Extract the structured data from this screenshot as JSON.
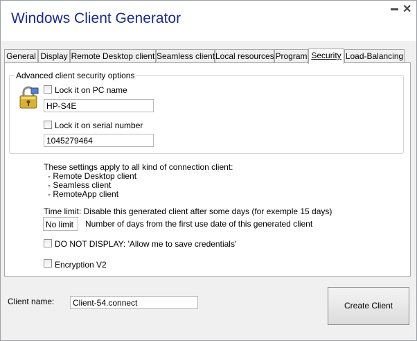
{
  "window": {
    "title": "Windows Client Generator",
    "minimize_glyph": "_",
    "close_glyph": "✕"
  },
  "tabs": [
    {
      "label": "General"
    },
    {
      "label": "Display"
    },
    {
      "label": "Remote Desktop client"
    },
    {
      "label": "Seamless client"
    },
    {
      "label": "Local resources"
    },
    {
      "label": "Program"
    },
    {
      "label": "Security"
    },
    {
      "label": "Load-Balancing"
    }
  ],
  "active_tab": "Security",
  "security": {
    "group_title": "Advanced client security options",
    "lock_pc": {
      "label": "Lock it on PC name",
      "checked": false,
      "value": "HP-S4E"
    },
    "lock_serial": {
      "label": "Lock it on serial number",
      "checked": false,
      "value": "1045279464"
    },
    "note": {
      "heading": "These settings apply to all kind of connection client:",
      "items": [
        "- Remote Desktop client",
        "- Seamless client",
        "- RemoteApp client"
      ]
    },
    "time_limit": {
      "label": "Time limit: Disable this generated client after some days (for exemple 15 days)",
      "value": "No limit",
      "description": "Number of days from the first use date of this generated client"
    },
    "do_not_display": {
      "label": "DO NOT DISPLAY: 'Allow me to save credentials'",
      "checked": false
    },
    "encryption": {
      "label": "Encryption V2",
      "checked": false
    }
  },
  "footer": {
    "client_name_label": "Client name:",
    "client_name_value": "Client-54.connect",
    "create_button": "Create Client"
  }
}
